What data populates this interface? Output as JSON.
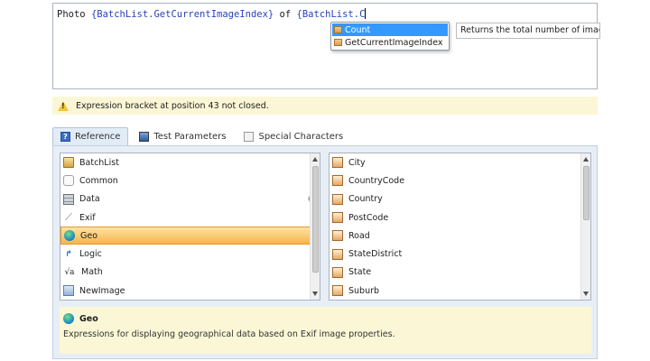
{
  "editor": {
    "text_plain_1": "Photo ",
    "text_blue_1": "{BatchList.GetCurrentImageIndex}",
    "text_plain_2": " of ",
    "text_blue_2": "{BatchList.C"
  },
  "intellisense": {
    "items": [
      {
        "label": "Count",
        "selected": true,
        "icon": "property-icon"
      },
      {
        "label": "GetCurrentImageIndex",
        "selected": false,
        "icon": "property-icon"
      }
    ],
    "tooltip": "Returns the total number of images in"
  },
  "status": {
    "icon": "warning-icon",
    "message": "Expression bracket at position 43 not closed."
  },
  "tabs": [
    {
      "label": "Reference",
      "icon": "reference-icon",
      "active": true
    },
    {
      "label": "Test Parameters",
      "icon": "monitor-icon",
      "active": false
    },
    {
      "label": "Special Characters",
      "icon": "special-characters-icon",
      "active": false
    }
  ],
  "categories": [
    {
      "label": "BatchList",
      "icon": "batch-icon"
    },
    {
      "label": "Common",
      "icon": "common-icon"
    },
    {
      "label": "Data",
      "icon": "data-icon"
    },
    {
      "label": "Exif",
      "icon": "exif-icon"
    },
    {
      "label": "Geo",
      "icon": "globe-icon",
      "selected": true
    },
    {
      "label": "Logic",
      "icon": "logic-icon"
    },
    {
      "label": "Math",
      "icon": "math-icon"
    },
    {
      "label": "NewImage",
      "icon": "new-image-icon"
    }
  ],
  "properties": [
    {
      "label": "City"
    },
    {
      "label": "CountryCode"
    },
    {
      "label": "Country"
    },
    {
      "label": "PostCode"
    },
    {
      "label": "Road"
    },
    {
      "label": "StateDistrict"
    },
    {
      "label": "State"
    },
    {
      "label": "Suburb"
    }
  ],
  "description": {
    "title": "Geo",
    "text": "Expressions for displaying geographical data based on Exif image properties."
  },
  "colors": {
    "accent_blue": "#3399ff",
    "selection_orange": "#f8b448",
    "info_yellow": "#fbf7d6",
    "code_blue": "#2a43b8"
  }
}
